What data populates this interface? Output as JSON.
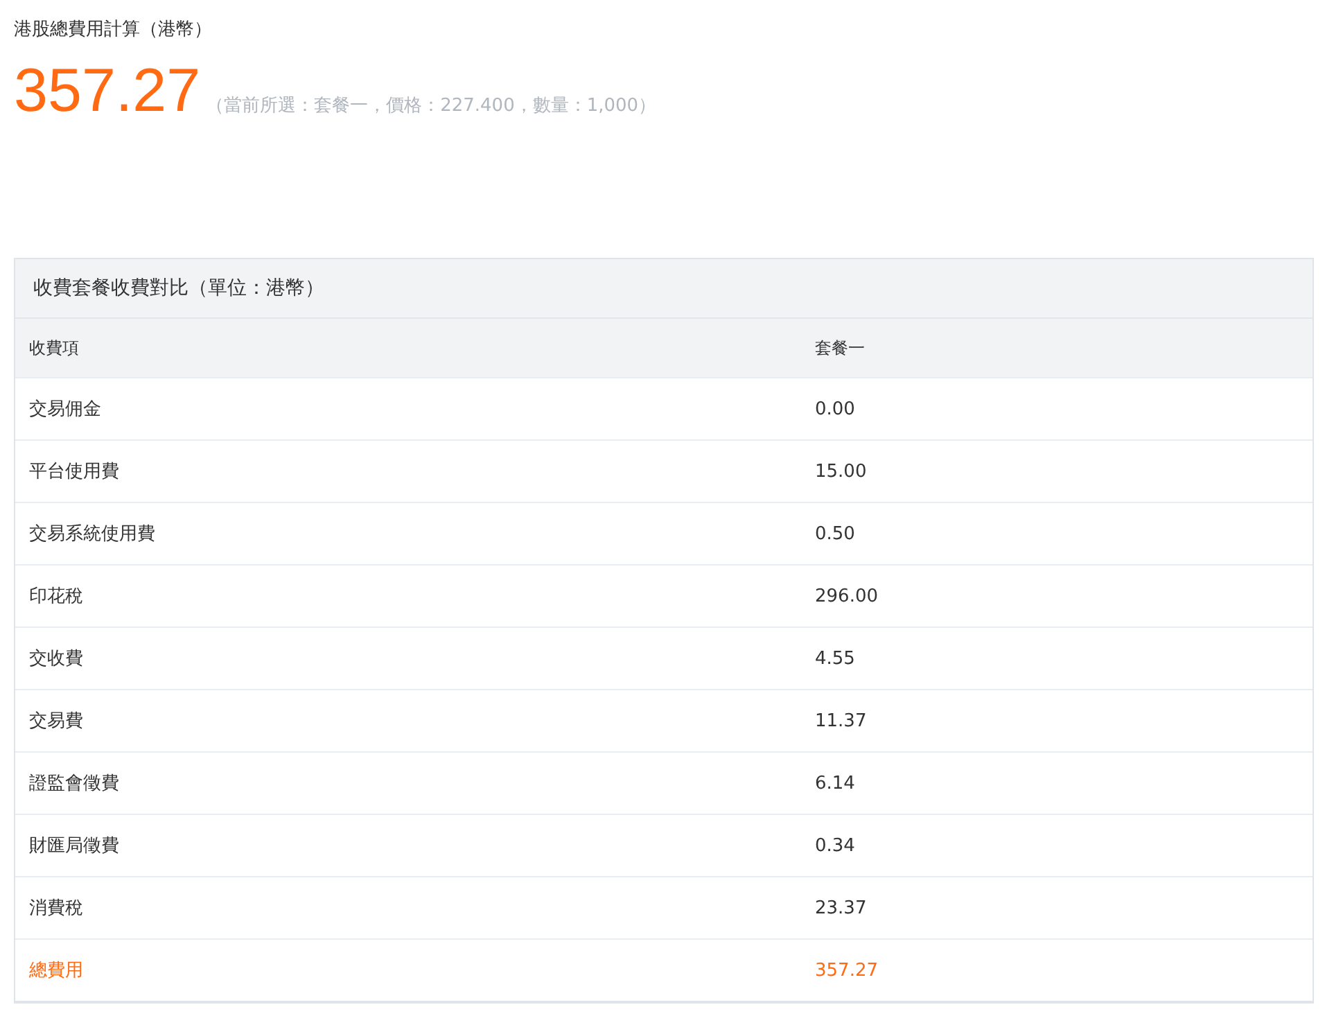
{
  "title": "港股總費用計算（港幣）",
  "total": "357.27",
  "summary": "（當前所選：套餐一，價格：227.400，數量：1,000）",
  "table": {
    "caption": "收費套餐收費對比（單位：港幣）",
    "columns": [
      "收費項",
      "套餐一"
    ],
    "rows": [
      {
        "kind": "item",
        "cells": [
          "交易佣金",
          "0.00"
        ]
      },
      {
        "kind": "item",
        "cells": [
          "平台使用費",
          "15.00"
        ]
      },
      {
        "kind": "item",
        "cells": [
          "交易系統使用費",
          "0.50"
        ]
      },
      {
        "kind": "item",
        "cells": [
          "印花稅",
          "296.00"
        ]
      },
      {
        "kind": "item",
        "cells": [
          "交收費",
          "4.55"
        ]
      },
      {
        "kind": "item",
        "cells": [
          "交易費",
          "11.37"
        ]
      },
      {
        "kind": "item",
        "cells": [
          "證監會徵費",
          "6.14"
        ]
      },
      {
        "kind": "item",
        "cells": [
          "財匯局徵費",
          "0.34"
        ]
      },
      {
        "kind": "item",
        "cells": [
          "消費稅",
          "23.37"
        ]
      },
      {
        "kind": "total",
        "cells": [
          "總費用",
          "357.27"
        ]
      }
    ]
  }
}
